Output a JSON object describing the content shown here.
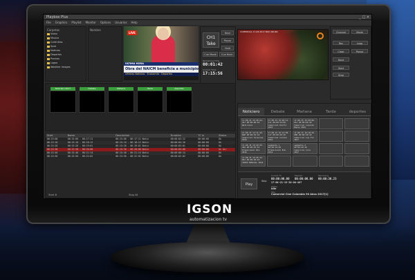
{
  "app": {
    "window_title": "Playbox Plus",
    "menu": [
      "File",
      "Graphics",
      "Playlist",
      "Monitor",
      "Options",
      "Usuarios",
      "Help"
    ],
    "window_controls": "_ □ ×"
  },
  "tree": {
    "title": "Carpetas",
    "items": [
      "Video",
      "Musica",
      "Cortinillas",
      "Spot",
      "Noticias",
      "Deportes",
      "Promos",
      "Logos",
      "Weather Images"
    ]
  },
  "filelist": {
    "title": "Nombre"
  },
  "video": {
    "live_badge": "LIVE",
    "ticker_top": "ÚLTIMA HORA",
    "headline": "Obra del NAICM beneficia a municipios del Edomex",
    "ticker_bottom": "Últimas Noticias · Economía · Deportes"
  },
  "control": {
    "channel": "CH1",
    "take": "Take",
    "next": "Next",
    "pause": "Pause",
    "hold": "Hold",
    "cue_mode": "Cue Mode",
    "cue_next": "Cue Next",
    "remaining_label": "Remaining Time",
    "remaining": "00:01:42",
    "current_label": "Current Time",
    "current": "17:15:56"
  },
  "preview": {
    "caption": "COMERCIAL 17-08-2017 BOX ANUNC"
  },
  "right_controls": {
    "buttons": [
      "Channel",
      "Mode",
      "Rec",
      "Loop",
      "Clear",
      "Pause",
      "Next",
      "Start",
      "Stop"
    ]
  },
  "thumbs": {
    "labels": [
      "Noticiero 2017",
      "Debate",
      "Mañana",
      "Tarde",
      "deportes"
    ]
  },
  "playlist": {
    "columns": [
      "Start",
      "Name",
      "Description",
      "Duration",
      "TC In",
      "Status"
    ],
    "rows": [
      [
        "06:15:00",
        "06:15:00 - 06:17:11",
        "06:15:00 - 06:17:11 Notic",
        "00:00:02:12",
        "00:00:00",
        "Ok"
      ],
      [
        "06:15:10",
        "06:15:10 - 06:18:12",
        "06:15:10 - 06:18:12 Notic",
        "00:00:04:10",
        "00:00:00",
        "Ok"
      ],
      [
        "06:15:20",
        "06:15:20 - 06:19:01",
        "06:15:20 - 06:19:01 Notic",
        "00:00:03:01",
        "00:00:00",
        "Ok"
      ],
      [
        "06:15:30",
        "06:15:30 - 06:20:08",
        "06:15:30 - 06:20:08 Notic",
        "00:00:05:08",
        "00:00:00",
        "On Air"
      ],
      [
        "06:15:40",
        "06:15:40 - 06:21:14",
        "06:15:40 - 06:21:14 Notic",
        "00:00:06:14",
        "00:00:00",
        "Ok"
      ],
      [
        "06:15:50",
        "06:15:50 - 06:22:02",
        "06:15:50 - 06:22:02 Notic",
        "00:00:02:02",
        "00:00:00",
        "Ok"
      ]
    ],
    "footer_left": "Start B",
    "footer_right": "Stop All"
  },
  "cart": {
    "tabs": [
      "Noticiero",
      "Debate",
      "Mañana",
      "Tarde",
      "deportes"
    ],
    "cells": [
      "17-08-15 15:20:44-447 00:00:00:10 Noticiero",
      "17-08-15 15:20:11-111 00:00:34:09 Comercial Unifil 2015",
      "17-08-15 15:20:09-011 00:00:06:10 Comercial Liquido Manos 2015",
      "",
      "",
      "17-08-15 14:11:10-000 00:00:19:10 Comercial Televisa 2016",
      "17-08-15 16:14:58-117 00:00:30:10 Comercial Corona 2014",
      "17-08-15 16:18:34-000 00:00:30:10 Comercial Lig Fin 2017",
      "",
      "",
      "17-08-15 16:29:35-459 00:00:25:10 Promocional Bim 2016",
      "segmento 1 00:00:19:02 Promocional Bim 2014",
      "segmento 2 00:00:20:10 Comercial Cine 2017",
      "",
      "",
      "17-08-15 16:45:12-001 00:00:30:10 VIDEO MUSICAL 2016",
      "",
      "",
      "",
      ""
    ],
    "play": "Play",
    "skip": "Skip",
    "current_label": "Current TC",
    "current_tc": "00:00:00.00",
    "elapsed_label": "Elapsed",
    "elapsed": "00:00:00.00",
    "remaining_label": "Remaining",
    "remaining": "00:00:30.23",
    "clip_id": "17-08-21-15-30-00-497",
    "status_label": "Status",
    "status": "Idle",
    "title_label": "Title",
    "title": "Comercial Cine Colombia 90 Años 2017[1]"
  },
  "brand": {
    "name": "IGSON",
    "tagline": "automatizacion tv"
  }
}
